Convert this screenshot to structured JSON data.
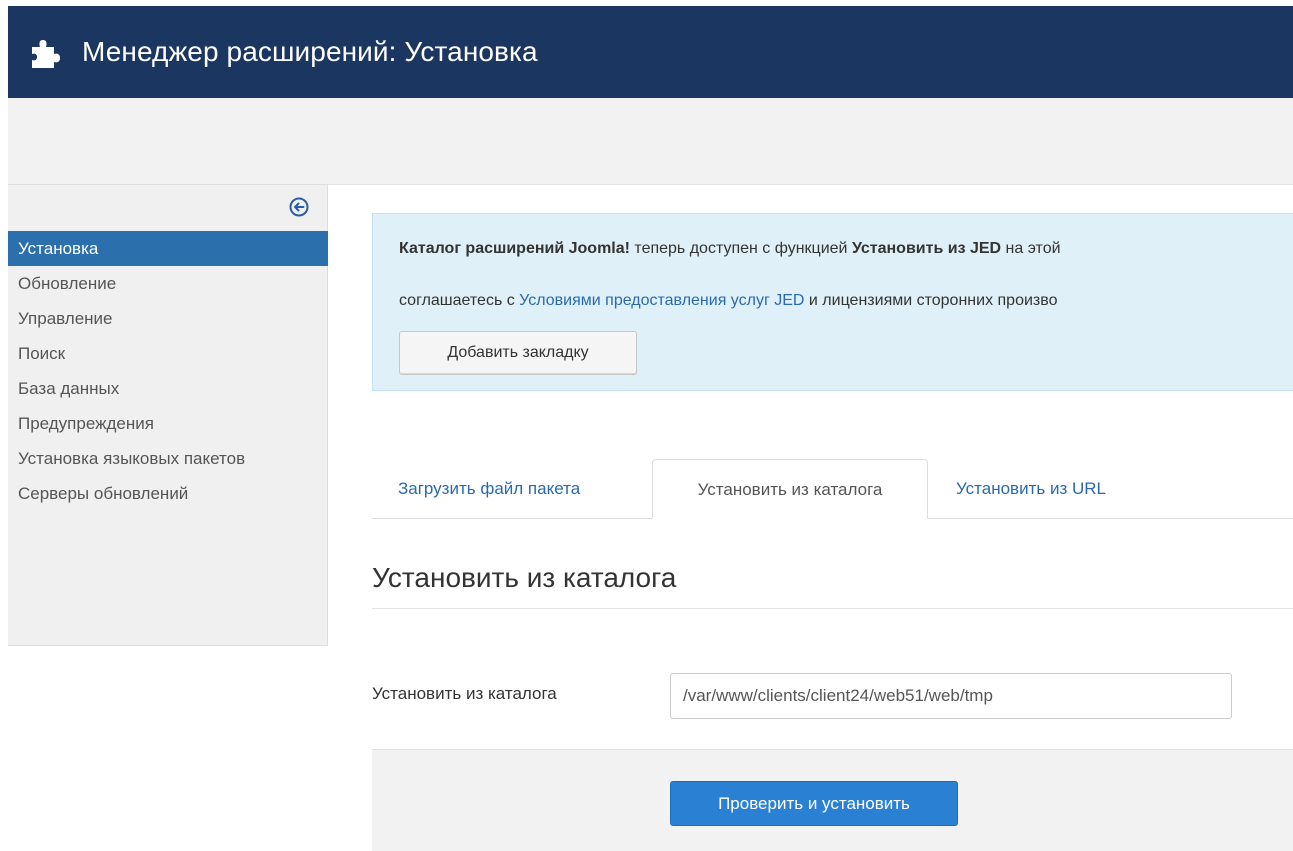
{
  "header": {
    "title": "Менеджер расширений: Установка",
    "icon": "puzzle-icon"
  },
  "sidebar": {
    "items": [
      {
        "label": "Установка",
        "active": true
      },
      {
        "label": "Обновление"
      },
      {
        "label": "Управление"
      },
      {
        "label": "Поиск"
      },
      {
        "label": "База данных"
      },
      {
        "label": "Предупреждения"
      },
      {
        "label": "Установка языковых пакетов"
      },
      {
        "label": "Серверы обновлений"
      }
    ],
    "toggle_icon": "arrow-left-circle-icon"
  },
  "alert": {
    "line1_bold1": "Каталог расширений Joomla!",
    "line1_text1": " теперь доступен с функцией ",
    "line1_bold2": "Установить из JED",
    "line1_text2": " на этой",
    "line2_text1": "соглашаетесь с ",
    "line2_link": "Условиями предоставления услуг JED",
    "line2_text2": " и лицензиями сторонних произво",
    "button_label": "Добавить закладку"
  },
  "tabs": [
    {
      "label": "Загрузить файл пакета",
      "active": false
    },
    {
      "label": "Установить из каталога",
      "active": true
    },
    {
      "label": "Установить из URL",
      "active": false
    }
  ],
  "section": {
    "title": "Установить из каталога"
  },
  "form": {
    "label": "Установить из каталога",
    "value": "/var/www/clients/client24/web51/web/tmp"
  },
  "actions": {
    "submit_label": "Проверить и установить"
  },
  "colors": {
    "header_bg": "#1b3660",
    "active_item": "#2b6fac",
    "link": "#2a6aac",
    "primary_button": "#2a81d3",
    "alert_bg": "#dff0f8"
  }
}
